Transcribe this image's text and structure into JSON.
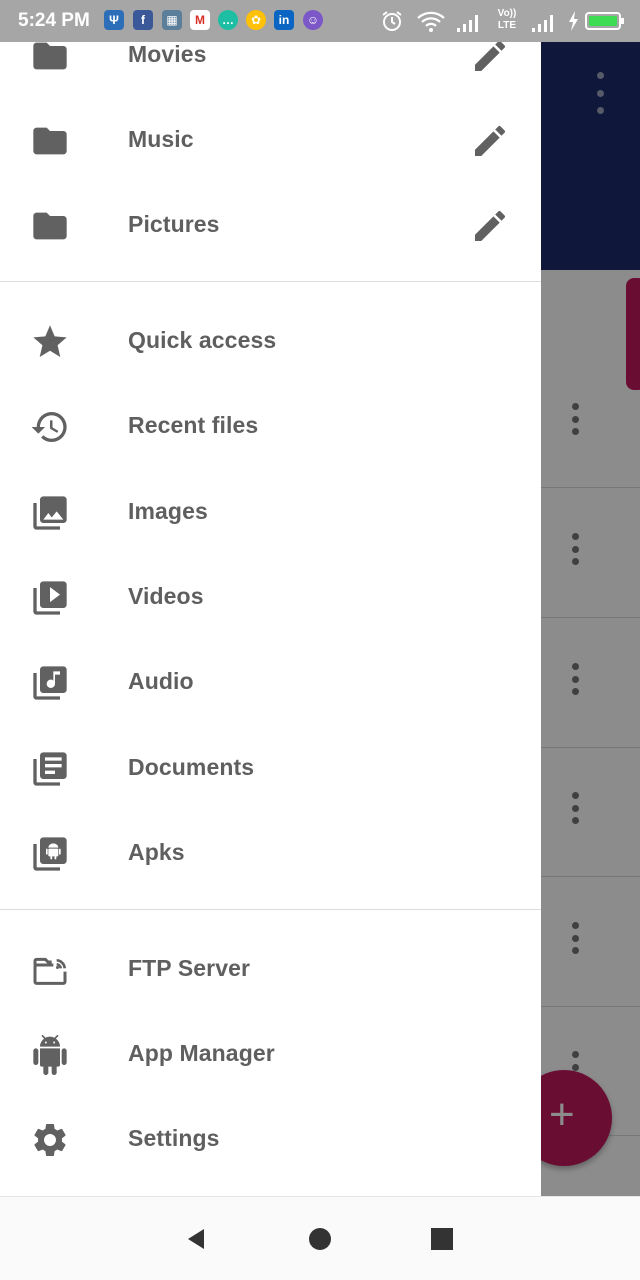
{
  "status_bar": {
    "time": "5:24 PM",
    "network_label_top": "Vo))",
    "network_label_bottom": "LTE",
    "app_icons": [
      "usb-icon",
      "facebook-icon",
      "gallery-icon",
      "gmail-icon",
      "messenger-icon",
      "sunflower-app-icon",
      "linkedin-icon",
      "bot-app-icon"
    ],
    "status_icons": [
      "alarm-icon",
      "wifi-icon",
      "signal-icon",
      "volte-icon",
      "signal-icon",
      "charging-icon",
      "battery-icon"
    ]
  },
  "drawer": {
    "bookmarks": [
      {
        "label": "Movies",
        "icon": "folder-icon",
        "action": "edit-icon"
      },
      {
        "label": "Music",
        "icon": "folder-icon",
        "action": "edit-icon"
      },
      {
        "label": "Pictures",
        "icon": "folder-icon",
        "action": "edit-icon"
      }
    ],
    "categories": [
      {
        "label": "Quick access",
        "icon": "star-icon"
      },
      {
        "label": "Recent files",
        "icon": "history-icon"
      },
      {
        "label": "Images",
        "icon": "image-library-icon"
      },
      {
        "label": "Videos",
        "icon": "video-library-icon"
      },
      {
        "label": "Audio",
        "icon": "music-library-icon"
      },
      {
        "label": "Documents",
        "icon": "document-library-icon"
      },
      {
        "label": "Apks",
        "icon": "apk-library-icon"
      }
    ],
    "tools": [
      {
        "label": "FTP Server",
        "icon": "ftp-server-icon"
      },
      {
        "label": "App Manager",
        "icon": "android-icon"
      },
      {
        "label": "Settings",
        "icon": "gear-icon"
      }
    ]
  },
  "background": {
    "toolbar_color": "#1c2a6c",
    "accent_color": "#c2185b",
    "fab_label": "+",
    "row_count": 6
  },
  "nav_bar": {
    "buttons": [
      "back-icon",
      "home-icon",
      "recents-icon"
    ]
  },
  "colors": {
    "drawer_text": "#5f5f5f",
    "icon": "#616161",
    "status_bar": "#a6a6a6"
  }
}
